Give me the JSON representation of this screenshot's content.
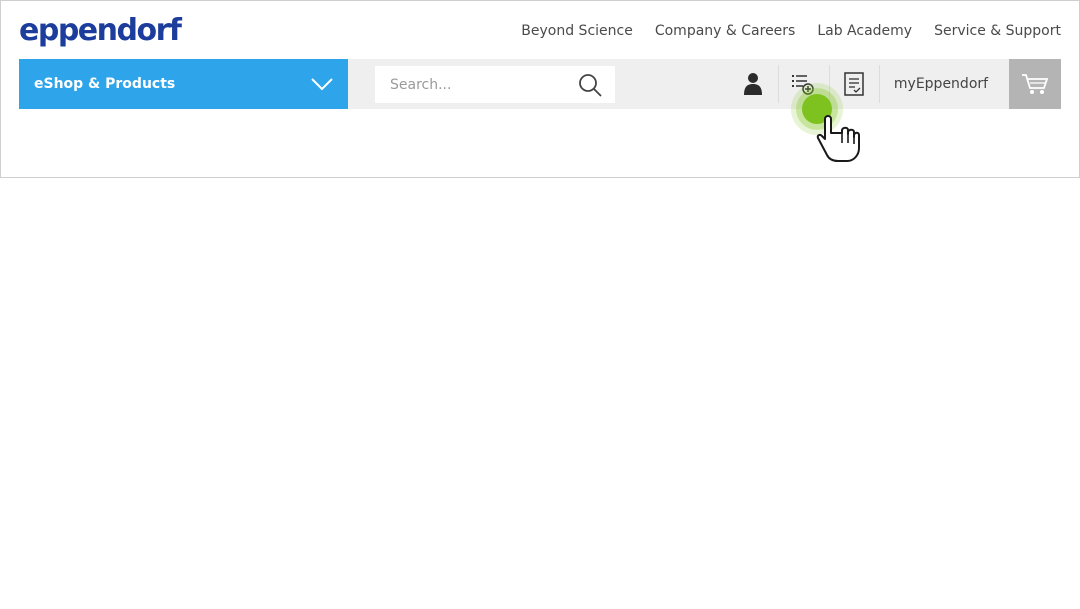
{
  "logo": {
    "text": "eppendorf"
  },
  "top_nav": {
    "items": [
      "Beyond Science",
      "Company & Careers",
      "Lab Academy",
      "Service & Support"
    ]
  },
  "eshop": {
    "label": "eShop & Products",
    "icon": "chevron-down-icon"
  },
  "search": {
    "placeholder": "Search...",
    "value": "",
    "icon": "search-icon"
  },
  "toolbar": {
    "account_icon": "user-icon",
    "list_icon": "add-to-list-icon",
    "quote_icon": "document-icon",
    "my_label": "myEppendorf",
    "cart_icon": "cart-icon"
  },
  "colors": {
    "brand": "#1d3d9c",
    "eshop_bg": "#2ea4ea",
    "bar_bg": "#efefef",
    "cart_bg": "#b4b4b4",
    "click_highlight": "#7dc21e"
  }
}
